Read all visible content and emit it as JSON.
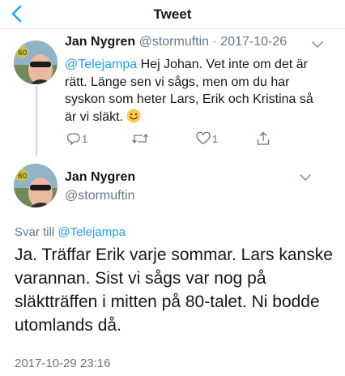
{
  "header": {
    "title": "Tweet"
  },
  "reply_tweet": {
    "name": "Jan Nygren",
    "handle_date": "@stormuftin · 2017-10-26",
    "text": {
      "mention": "@Telejampa",
      "body": " Hej Johan. Vet inte om det är rätt. Länge sen vi sågs, men om du har syskon som heter Lars, Erik och Kristina så är vi släkt. "
    },
    "actions": {
      "reply_count": "1",
      "retweet_count": "",
      "like_count": "1"
    }
  },
  "main_tweet": {
    "name": "Jan Nygren",
    "handle": "@stormuftin",
    "reply_to_label": "Svar till ",
    "reply_to_mention": "@Telejampa",
    "text": "Ja. Träffar Erik varje sommar. Lars kanske varannan. Sist vi sågs var nog på släktträffen i mitten på 80-talet. Ni bodde utomlands då.",
    "timestamp": "2017-10-29 23:16"
  },
  "colors": {
    "accent": "#1da1f2",
    "muted": "#657786",
    "text": "#14171a",
    "divider": "#e6ecf0"
  }
}
